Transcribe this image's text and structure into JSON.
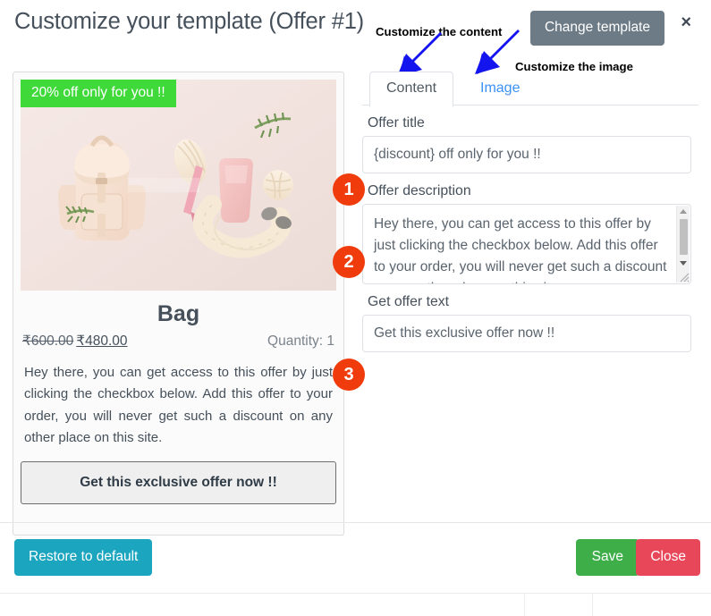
{
  "header": {
    "title": "Customize your template (Offer #1)",
    "change_template_label": "Change template",
    "close_icon": "×"
  },
  "annotations": {
    "content_note": "Customize the content",
    "image_note": "Customize the image",
    "arrow_color": "#1414ee",
    "badges": [
      {
        "number": "1",
        "target": "Offer title"
      },
      {
        "number": "2",
        "target": "Offer description"
      },
      {
        "number": "3",
        "target": "Get offer text"
      }
    ],
    "badge_color": "#f03c0c"
  },
  "preview": {
    "offer_badge": "20% off only for you !!",
    "offer_badge_color": "#3fd93a",
    "product_name": "Bag",
    "price_old": "₹600.00",
    "price_new": "₹480.00",
    "quantity_label": "Quantity: 1",
    "description": "Hey there, you can get access to this offer by just clicking the checkbox below. Add this offer to your order, you will never get such a discount on any other place on this site.",
    "cta_label": "Get this exclusive offer now !!"
  },
  "tabs": [
    {
      "label": "Content",
      "active": true
    },
    {
      "label": "Image",
      "active": false
    }
  ],
  "form": {
    "offer_title": {
      "label": "Offer title",
      "value": "{discount} off only for you !!"
    },
    "offer_description": {
      "label": "Offer description",
      "value": "Hey there, you can get access to this offer by just clicking the checkbox below. Add this offer to your order, you will never get such a discount on any other place on this site."
    },
    "get_offer_text": {
      "label": "Get offer text",
      "value": "Get this exclusive offer now !!"
    }
  },
  "footer": {
    "restore_label": "Restore to default",
    "save_label": "Save",
    "close_label": "Close",
    "restore_color": "#1ba5bf",
    "save_color": "#3eae49",
    "close_color": "#e8475a"
  }
}
